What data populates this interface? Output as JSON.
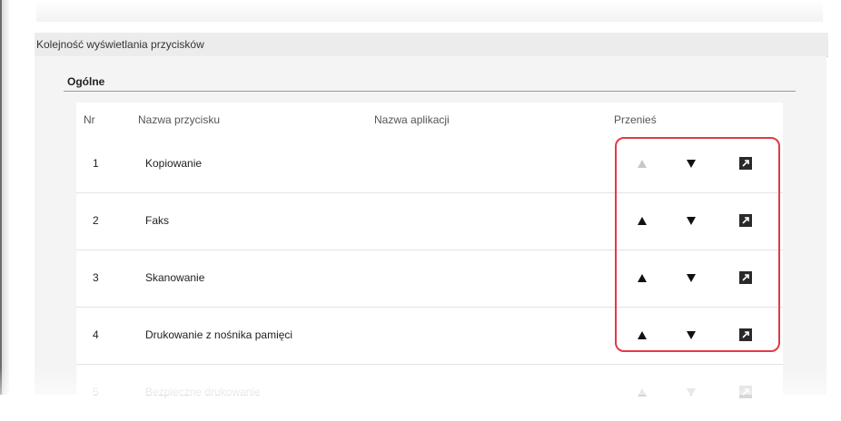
{
  "section": {
    "title": "Kolejność wyświetlania przycisków"
  },
  "group": {
    "title": "Ogólne"
  },
  "columns": {
    "nr": "Nr",
    "button_name": "Nazwa przycisku",
    "app_name": "Nazwa aplikacji",
    "move": "Przenieś"
  },
  "rows": [
    {
      "nr": "1",
      "name": "Kopiowanie",
      "app": "",
      "up_enabled": false
    },
    {
      "nr": "2",
      "name": "Faks",
      "app": "",
      "up_enabled": true
    },
    {
      "nr": "3",
      "name": "Skanowanie",
      "app": "",
      "up_enabled": true
    },
    {
      "nr": "4",
      "name": "Drukowanie z nośnika pamięci",
      "app": "",
      "up_enabled": true
    },
    {
      "nr": "5",
      "name": "Bezpieczne drukowanie",
      "app": "",
      "up_enabled": true
    }
  ],
  "icons": {
    "up": "move-up-icon",
    "down": "move-down-icon",
    "edit": "edit-icon"
  },
  "colors": {
    "highlight": "#e53945",
    "disabled_arrow": "#c8c8c8"
  }
}
